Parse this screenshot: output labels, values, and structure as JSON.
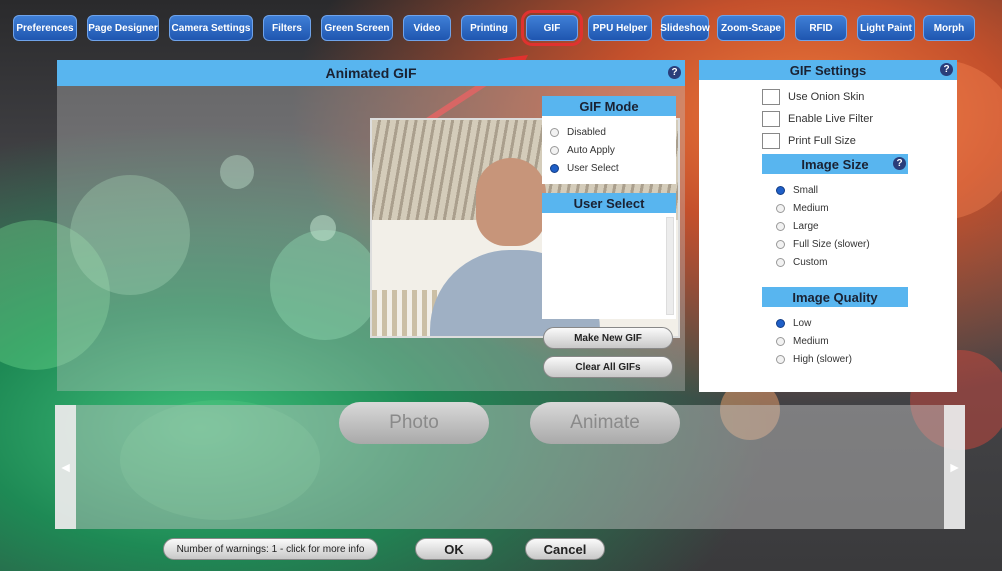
{
  "tabs": [
    "Preferences",
    "Page Designer",
    "Camera Settings",
    "Filters",
    "Green Screen",
    "Video",
    "Printing",
    "GIF",
    "PPU Helper",
    "Slideshow",
    "Zoom-Scape",
    "RFID",
    "Light Paint",
    "Morph"
  ],
  "animated_gif": {
    "title": "Animated GIF",
    "help": "?"
  },
  "gif_mode": {
    "title": "GIF Mode",
    "options": [
      "Disabled",
      "Auto Apply",
      "User Select"
    ],
    "selected": "User Select"
  },
  "user_select": {
    "title": "User Select"
  },
  "actions": {
    "make_new": "Make New GIF",
    "clear_all": "Clear All GIFs"
  },
  "gif_settings": {
    "title": "GIF Settings",
    "help": "?",
    "checkboxes": [
      "Use Onion Skin",
      "Enable Live Filter",
      "Print Full Size"
    ],
    "image_size": {
      "title": "Image Size",
      "help": "?",
      "options": [
        "Small",
        "Medium",
        "Large",
        "Full Size (slower)",
        "Custom"
      ],
      "selected": "Small"
    },
    "image_quality": {
      "title": "Image Quality",
      "options": [
        "Low",
        "Medium",
        "High (slower)"
      ],
      "selected": "Low"
    }
  },
  "bottom": {
    "photo": "Photo",
    "animate": "Animate",
    "left_arrow": "◄",
    "right_arrow": "►"
  },
  "footer": {
    "warnings": "Number of warnings: 1 - click for more info",
    "ok": "OK",
    "cancel": "Cancel"
  }
}
